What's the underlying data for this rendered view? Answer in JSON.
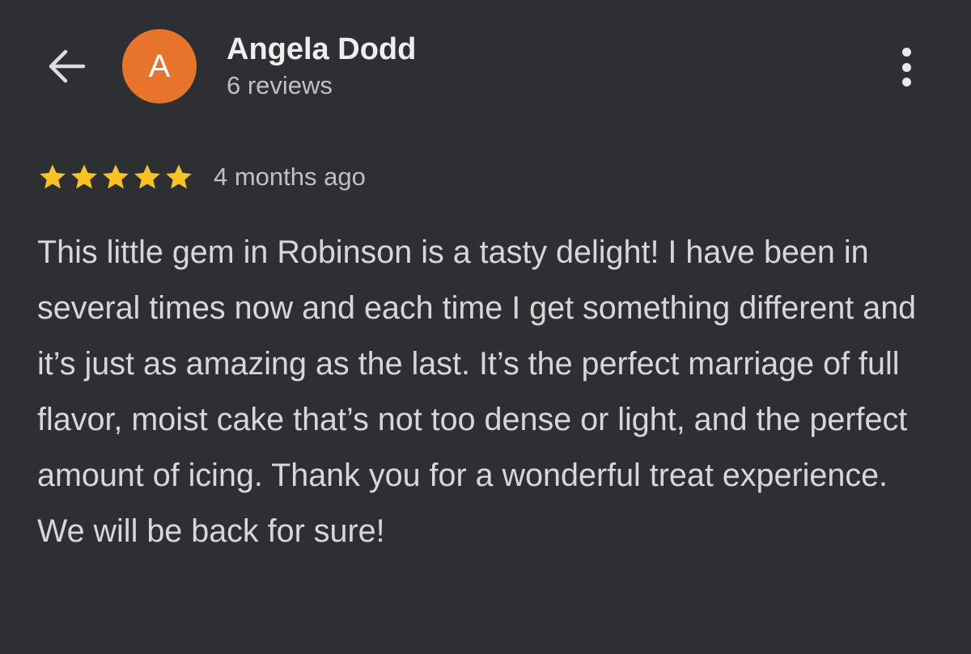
{
  "header": {
    "back_icon": "arrow-left-icon",
    "avatar_initial": "A",
    "avatar_color": "#e8742c",
    "reviewer_name": "Angela Dodd",
    "review_count": "6 reviews",
    "menu_icon": "more-vertical-icon"
  },
  "review": {
    "rating": 5,
    "max_rating": 5,
    "star_icon": "star-icon",
    "star_color": "#f7c325",
    "date": "4 months ago",
    "text": "This little gem in Robinson is a tasty delight! I have been in several times now and each time I get something different and it’s just as amazing as the last. It’s the perfect marriage of full flavor, moist cake that’s not too dense or light, and the perfect amount of icing. Thank you for a wonderful treat experience. We will be back for sure!"
  },
  "colors": {
    "background": "#2e2f32",
    "primary_text": "#e8eaed",
    "secondary_text": "#bdc1c6"
  }
}
